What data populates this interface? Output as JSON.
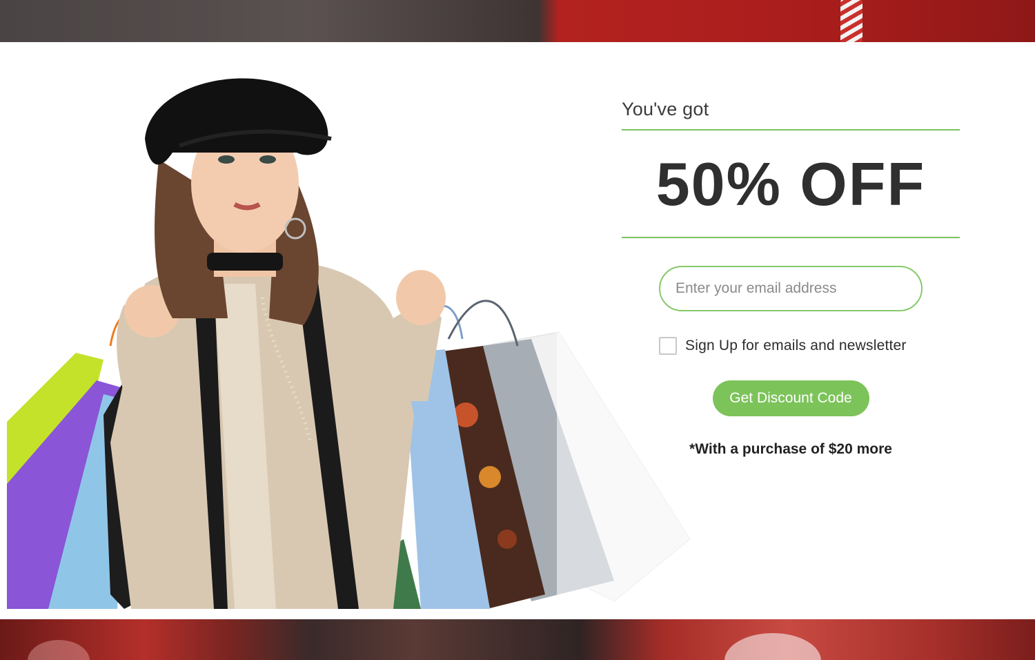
{
  "offer": {
    "eyebrow": "You've got",
    "headline": "50% OFF",
    "email_placeholder": "Enter your email address",
    "consent_label": "Sign Up for emails and newsletter",
    "cta_label": "Get Discount Code",
    "fineprint": "*With a purchase of $20 more"
  },
  "theme": {
    "accent": "#7cc35a",
    "text": "#2f2f2f"
  }
}
